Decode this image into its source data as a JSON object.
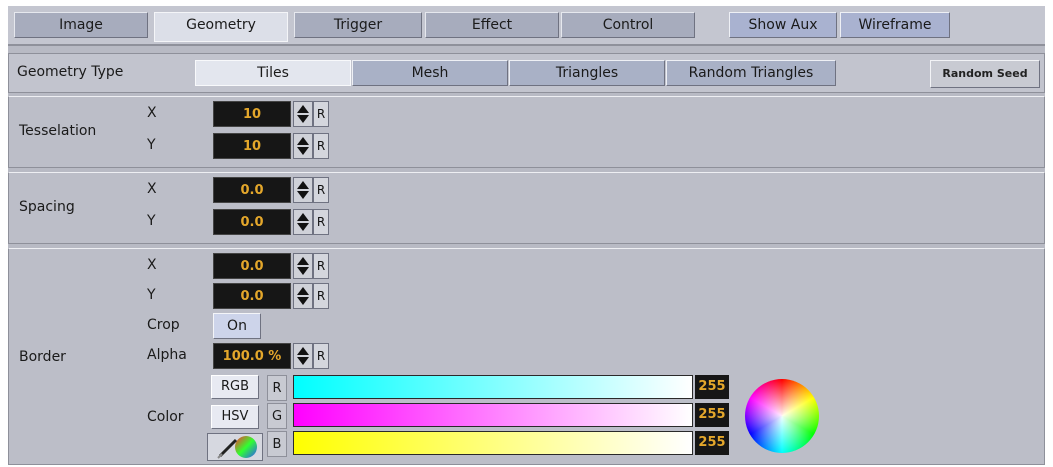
{
  "tabs": [
    {
      "label": "Image",
      "active": false
    },
    {
      "label": "Geometry",
      "active": true
    },
    {
      "label": "Trigger",
      "active": false
    },
    {
      "label": "Effect",
      "active": false
    },
    {
      "label": "Control",
      "active": false
    }
  ],
  "toggles": {
    "show_aux": "Show Aux",
    "wireframe": "Wireframe"
  },
  "geometry_type": {
    "label": "Geometry Type",
    "options": [
      "Tiles",
      "Mesh",
      "Triangles",
      "Random Triangles"
    ],
    "selected": "Tiles",
    "random_seed": "Random Seed"
  },
  "tesselation": {
    "label": "Tesselation",
    "x_label": "X",
    "y_label": "Y",
    "x": "10",
    "y": "10"
  },
  "spacing": {
    "label": "Spacing",
    "x_label": "X",
    "y_label": "Y",
    "x": "0.0",
    "y": "0.0"
  },
  "border": {
    "label": "Border",
    "x_label": "X",
    "y_label": "Y",
    "x": "0.0",
    "y": "0.0",
    "crop_label": "Crop",
    "crop": "On",
    "alpha_label": "Alpha",
    "alpha": "100.0 %",
    "color_label": "Color",
    "rgb_button": "RGB",
    "hsv_button": "HSV",
    "channels": [
      {
        "name": "R",
        "value": "255"
      },
      {
        "name": "G",
        "value": "255"
      },
      {
        "name": "B",
        "value": "255"
      }
    ]
  },
  "reset_label": "R",
  "colors": {
    "value_text": "#e4a72b",
    "panel": "#bcbec8",
    "tab_active": "#dcdfe8"
  }
}
